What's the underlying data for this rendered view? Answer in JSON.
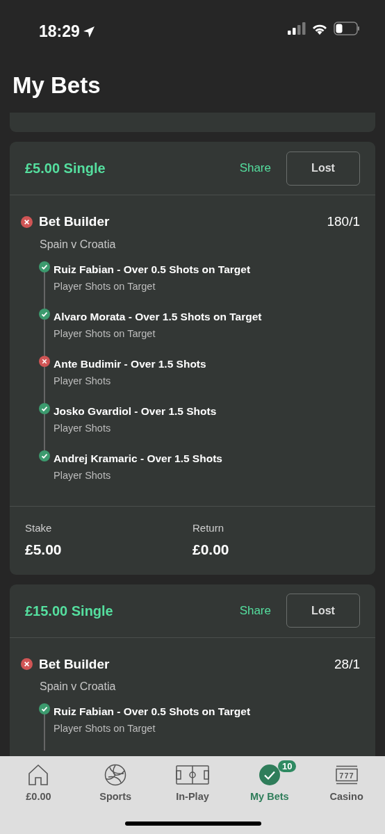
{
  "status_bar": {
    "time": "18:29"
  },
  "title": "My Bets",
  "bets": [
    {
      "heading": "£5.00 Single",
      "share": "Share",
      "result": "Lost",
      "market": "Bet Builder",
      "market_won": false,
      "odds": "180/1",
      "event": "Spain v Croatia",
      "legs": [
        {
          "selection": "Ruiz Fabian - Over 0.5 Shots on Target",
          "market": "Player Shots on Target",
          "won": true
        },
        {
          "selection": "Alvaro Morata - Over 1.5 Shots on Target",
          "market": "Player Shots on Target",
          "won": true
        },
        {
          "selection": "Ante Budimir - Over 1.5 Shots",
          "market": "Player Shots",
          "won": false
        },
        {
          "selection": "Josko Gvardiol - Over 1.5 Shots",
          "market": "Player Shots",
          "won": true
        },
        {
          "selection": "Andrej Kramaric - Over 1.5 Shots",
          "market": "Player Shots",
          "won": true
        }
      ],
      "stake_label": "Stake",
      "stake": "£5.00",
      "return_label": "Return",
      "return": "£0.00"
    },
    {
      "heading": "£15.00 Single",
      "share": "Share",
      "result": "Lost",
      "market": "Bet Builder",
      "market_won": false,
      "odds": "28/1",
      "event": "Spain v Croatia",
      "legs": [
        {
          "selection": "Ruiz Fabian - Over 0.5 Shots on Target",
          "market": "Player Shots on Target",
          "won": true
        }
      ]
    }
  ],
  "tab_bar": [
    {
      "kind": "home",
      "label": "£0.00",
      "selected": false
    },
    {
      "kind": "sports",
      "label": "Sports",
      "selected": false
    },
    {
      "kind": "inplay",
      "label": "In-Play",
      "selected": false
    },
    {
      "kind": "mybets",
      "label": "My Bets",
      "selected": true,
      "badge": "10"
    },
    {
      "kind": "casino",
      "label": "Casino",
      "selected": false,
      "icon_text": "777"
    }
  ]
}
